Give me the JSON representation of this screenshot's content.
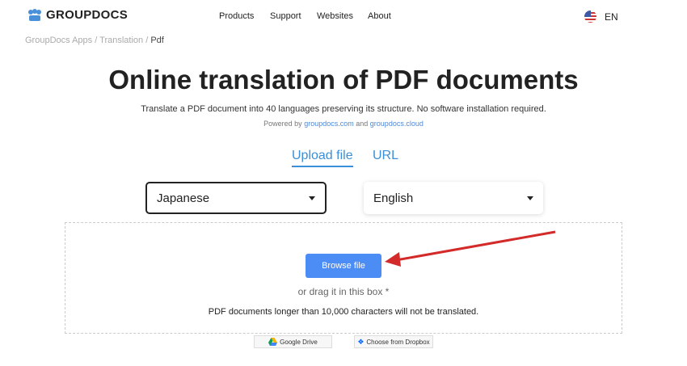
{
  "header": {
    "brand": "GROUPDOCS",
    "nav": [
      "Products",
      "Support",
      "Websites",
      "About"
    ],
    "lang": "EN"
  },
  "breadcrumb": {
    "items": [
      "GroupDocs Apps",
      "Translation"
    ],
    "current": "Pdf",
    "sep": "/"
  },
  "main": {
    "title": "Online translation of PDF documents",
    "subtitle": "Translate a PDF document into 40 languages preserving its structure. No software installation required.",
    "powered_prefix": "Powered by",
    "link1": "groupdocs.com",
    "and": "and",
    "link2": "groupdocs.cloud"
  },
  "tabs": [
    "Upload file",
    "URL"
  ],
  "source_lang": "Japanese",
  "target_lang": "English",
  "upload": {
    "browse": "Browse file",
    "drag": "or drag it in this box *",
    "note": "PDF documents longer than 10,000 characters will not be translated."
  },
  "cloud": {
    "gdrive": "Google Drive",
    "dropbox": "Choose from Dropbox"
  },
  "colors": {
    "accent": "#3b8fd8",
    "button": "#4c8cf5",
    "arrow": "#d32a2a"
  }
}
